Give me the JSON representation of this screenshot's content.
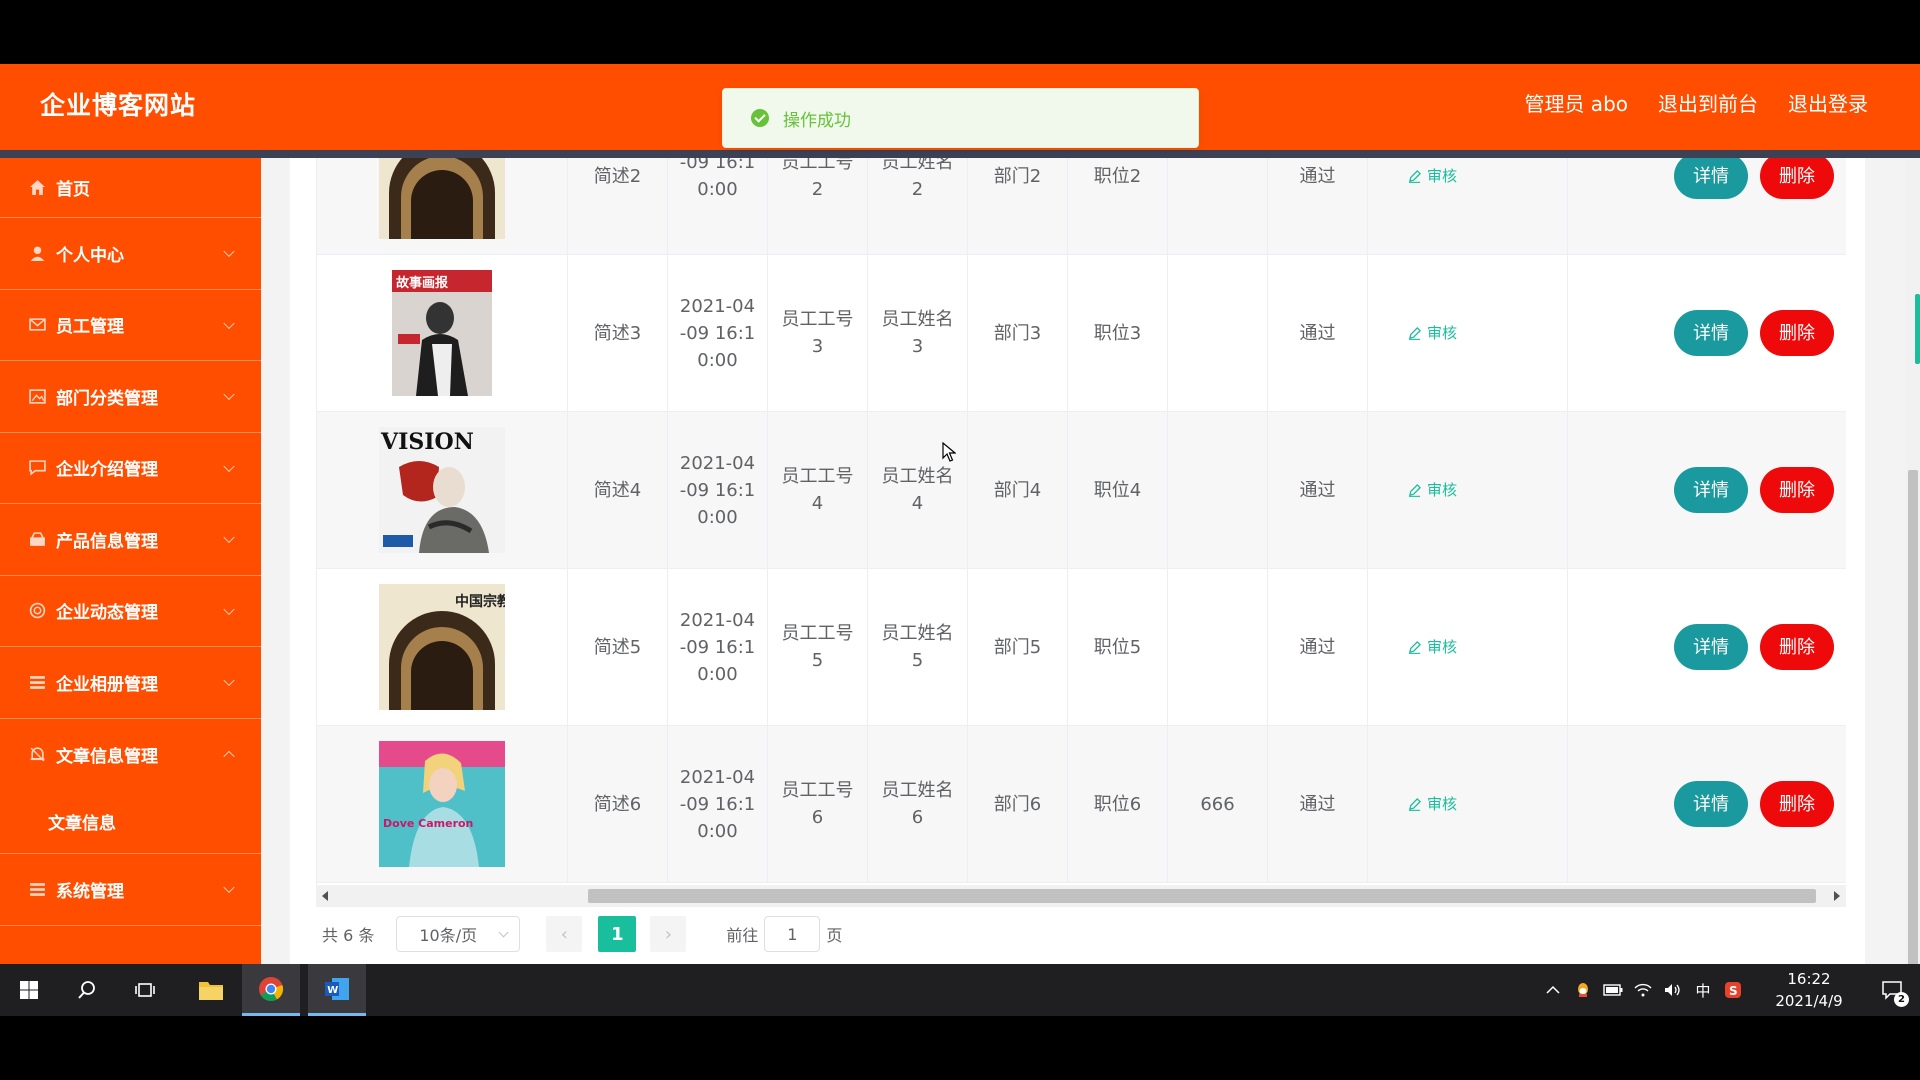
{
  "header": {
    "site_title": "企业博客网站",
    "admin_label": "管理员 abo",
    "back_to_front": "退出到前台",
    "logout": "退出登录"
  },
  "toast": {
    "message": "操作成功"
  },
  "sidebar": {
    "items": [
      {
        "label": "首页",
        "icon": "home-icon"
      },
      {
        "label": "个人中心",
        "icon": "user-icon"
      },
      {
        "label": "员工管理",
        "icon": "mail-icon"
      },
      {
        "label": "部门分类管理",
        "icon": "image-icon"
      },
      {
        "label": "企业介绍管理",
        "icon": "chat-icon"
      },
      {
        "label": "产品信息管理",
        "icon": "product-icon"
      },
      {
        "label": "企业动态管理",
        "icon": "globe-icon"
      },
      {
        "label": "企业相册管理",
        "icon": "list-icon"
      },
      {
        "label": "文章信息管理",
        "icon": "bell-icon"
      }
    ],
    "sub_item": "文章信息",
    "last_item": {
      "label": "系统管理",
      "icon": "list-icon"
    }
  },
  "table": {
    "rows": [
      {
        "desc": "简述2",
        "date": "-09 16:1\n0:00",
        "emp_no": "员工工号\n2",
        "emp_name": "员工姓名\n2",
        "dept": "部门2",
        "pos": "职位2",
        "remark": "",
        "status": "通过",
        "cover": "religion"
      },
      {
        "desc": "简述3",
        "date": "2021-04\n-09 16:1\n0:00",
        "emp_no": "员工工号\n3",
        "emp_name": "员工姓名\n3",
        "dept": "部门3",
        "pos": "职位3",
        "remark": "",
        "status": "通过",
        "cover": "pictorial"
      },
      {
        "desc": "简述4",
        "date": "2021-04\n-09 16:1\n0:00",
        "emp_no": "员工工号\n4",
        "emp_name": "员工姓名\n4",
        "dept": "部门4",
        "pos": "职位4",
        "remark": "",
        "status": "通过",
        "cover": "vision"
      },
      {
        "desc": "简述5",
        "date": "2021-04\n-09 16:1\n0:00",
        "emp_no": "员工工号\n5",
        "emp_name": "员工姓名\n5",
        "dept": "部门5",
        "pos": "职位5",
        "remark": "",
        "status": "通过",
        "cover": "religion"
      },
      {
        "desc": "简述6",
        "date": "2021-04\n-09 16:1\n0:00",
        "emp_no": "员工工号\n6",
        "emp_name": "员工姓名\n6",
        "dept": "部门6",
        "pos": "职位6",
        "remark": "666",
        "status": "通过",
        "cover": "fashion"
      }
    ],
    "audit_label": "审核",
    "detail_label": "详情",
    "delete_label": "删除",
    "cover_texts": {
      "religion": "中国宗教",
      "pictorial": "故事画报",
      "vision": "VISION",
      "fashion": "Dove Cameron"
    }
  },
  "pagination": {
    "total": "共 6 条",
    "page_size": "10条/页",
    "current_page": "1",
    "goto_label": "前往",
    "goto_value": "1",
    "goto_suffix": "页"
  },
  "taskbar": {
    "time": "16:22",
    "date": "2021/4/9",
    "ime": "中",
    "notifications": "2"
  },
  "colors": {
    "brand": "#ff4e00",
    "accent": "#19be9c",
    "detail": "#1a9a9e",
    "delete": "#ee0a0a"
  }
}
